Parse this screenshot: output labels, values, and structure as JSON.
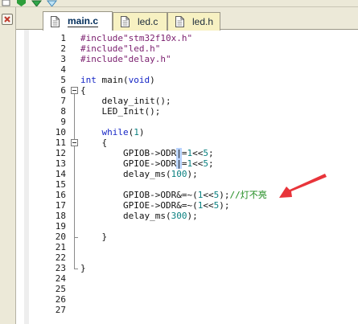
{
  "tabs": [
    {
      "id": "main",
      "label": "main.c",
      "active": true
    },
    {
      "id": "led_c",
      "label": "led.c",
      "active": false
    },
    {
      "id": "led_h",
      "label": "led.h",
      "active": false
    }
  ],
  "toolbar": {
    "icons": [
      "new-file-icon",
      "green-arrow-down-icon",
      "green-arrow-down-icon",
      "blue-arrow-down-icon"
    ]
  },
  "panel": {
    "close_icon": "close-icon",
    "close_color": "#c0392b"
  },
  "editor": {
    "line_numbers": [
      "1",
      "2",
      "3",
      "4",
      "5",
      "6",
      "7",
      "8",
      "9",
      "10",
      "11",
      "12",
      "13",
      "14",
      "15",
      "16",
      "17",
      "18",
      "19",
      "20",
      "21",
      "22",
      "23",
      "24",
      "25",
      "26",
      "27"
    ],
    "lines": [
      "#include\"stm32f10x.h\"",
      "#include\"led.h\"",
      "#include\"delay.h\"",
      "",
      "int main(void)",
      "{",
      "    delay_init();",
      "    LED_Init();",
      "",
      "    while(1)",
      "    {",
      "        GPIOB->ODR|=1<<5;",
      "        GPIOE->ODR|=1<<5;",
      "        delay_ms(100);",
      "",
      "        GPIOB->ODR&=~(1<<5);//灯不亮",
      "        GPIOE->ODR&=~(1<<5);",
      "        delay_ms(300);",
      "",
      "    }",
      "",
      "",
      "}",
      "",
      "",
      "",
      ""
    ]
  },
  "colors": {
    "preprocessor": "#7a1e6e",
    "keyword": "#1626c6",
    "number": "#0a8080",
    "comment": "#1b8a1b",
    "tab_inactive": "#f7f1c2",
    "annotation_arrow": "#e8343a"
  }
}
